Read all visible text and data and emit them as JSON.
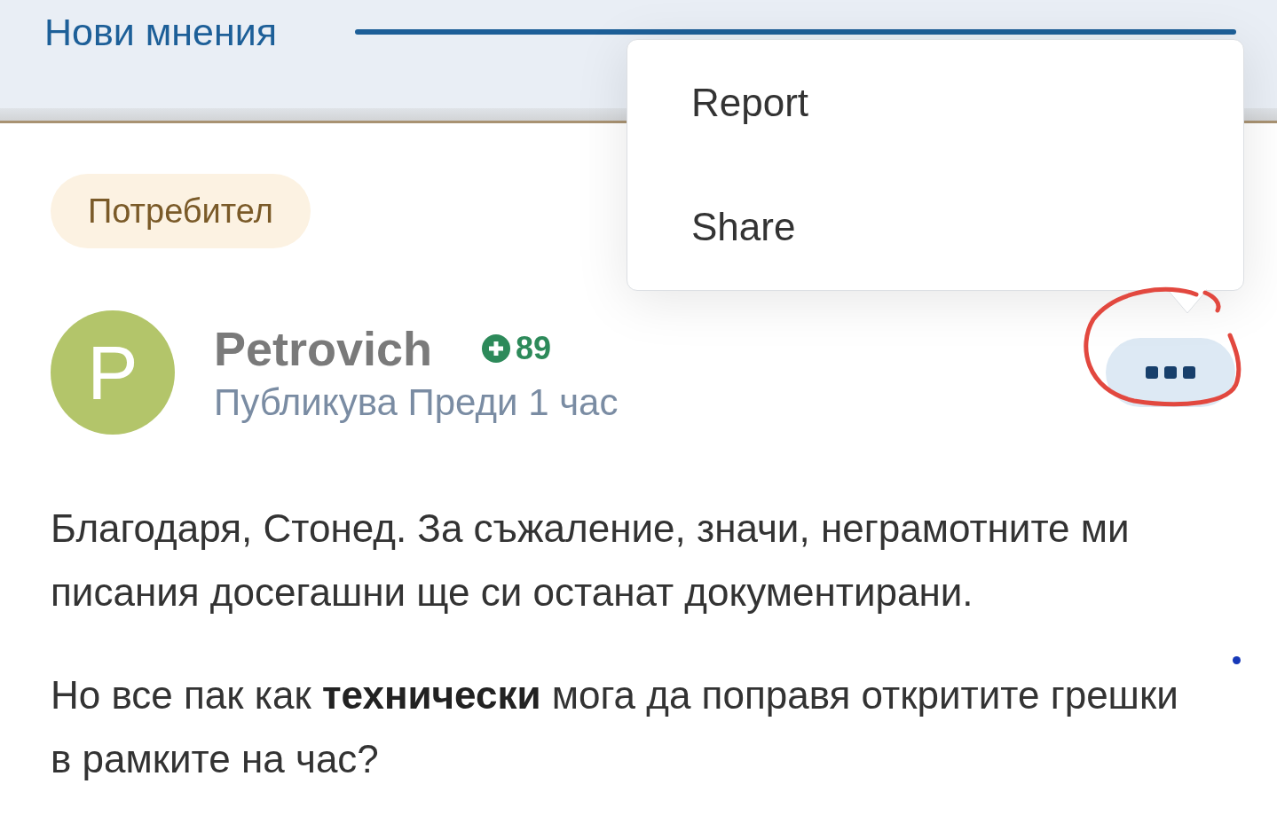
{
  "tab": {
    "label": "Нови мнения"
  },
  "post": {
    "role_badge": "Потребител",
    "author": {
      "initial": "P",
      "name": "Petrovich",
      "reputation": "89"
    },
    "meta": "Публикува Преди 1 час",
    "paragraphs": [
      "Благодаря, Стонед. За съжаление, значи, неграмотните ми писания досегашни ще си останат документирани.",
      "Но все пак как **технически** мога да поправя откритите грешки в рамките на час?"
    ]
  },
  "menu": {
    "items": [
      "Report",
      "Share"
    ]
  }
}
